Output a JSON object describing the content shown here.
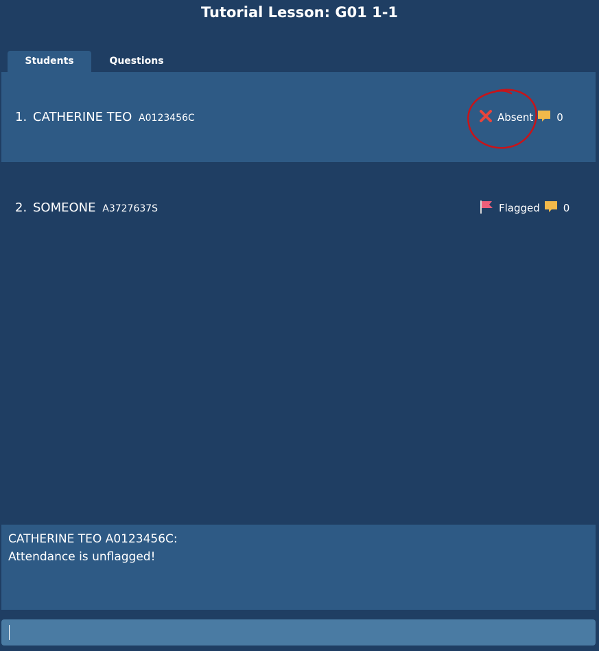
{
  "window": {
    "title": "Tutorial Lesson: G01 1-1"
  },
  "tabs": [
    {
      "label": "Students",
      "active": true
    },
    {
      "label": "Questions",
      "active": false
    }
  ],
  "students": [
    {
      "index": "1.",
      "name": "CATHERINE TEO",
      "id": "A0123456C",
      "status": "Absent",
      "status_icon": "cross-icon",
      "comments": "0",
      "selected": true
    },
    {
      "index": "2.",
      "name": "SOMEONE",
      "id": "A3727637S",
      "status": "Flagged",
      "status_icon": "flag-icon",
      "comments": "0",
      "selected": false
    }
  ],
  "result": {
    "line1": "CATHERINE TEO A0123456C:",
    "line2": "Attendance is unflagged!"
  },
  "command": {
    "value": ""
  },
  "colors": {
    "background": "#1f3e63",
    "panel": "#2e5a85",
    "command_box": "#4a7ba3",
    "absent_red": "#e8453c",
    "flag_pink": "#ee5f7a",
    "comment_yellow": "#f2b94a",
    "annotation_red": "#c81419"
  }
}
